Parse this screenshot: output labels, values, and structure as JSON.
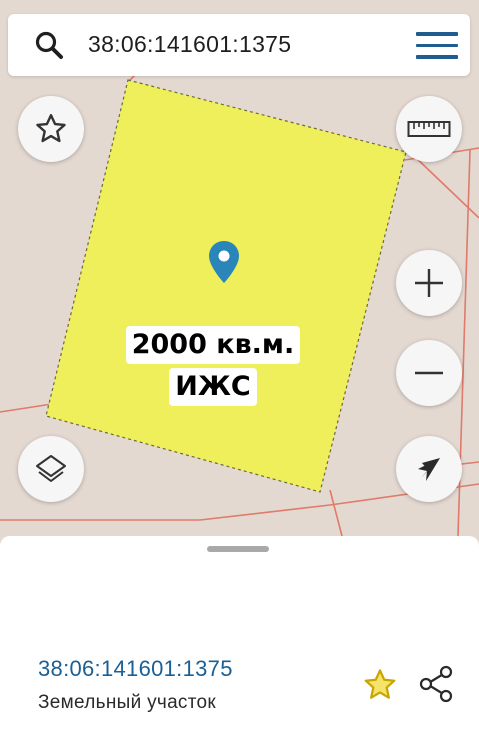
{
  "search": {
    "query": "38:06:141601:1375",
    "icon": "search-icon"
  },
  "menu": {
    "icon": "hamburger-menu-icon"
  },
  "map": {
    "plot_label_area": "2000 кв.м.",
    "plot_label_type": "ИЖС",
    "plot_color": "#efef5c",
    "boundary_color": "#e07a6a",
    "controls": {
      "favorite": "star-icon",
      "ruler": "ruler-icon",
      "zoom_in": "plus-icon",
      "zoom_out": "minus-icon",
      "layers": "layers-icon",
      "locate": "navigation-arrow-icon"
    },
    "accent": "#2a85b8"
  },
  "sheet": {
    "cadastral_number": "38:06:141601:1375",
    "object_type": "Земельный участок",
    "favorite_icon": "star-icon",
    "share_icon": "share-icon"
  }
}
